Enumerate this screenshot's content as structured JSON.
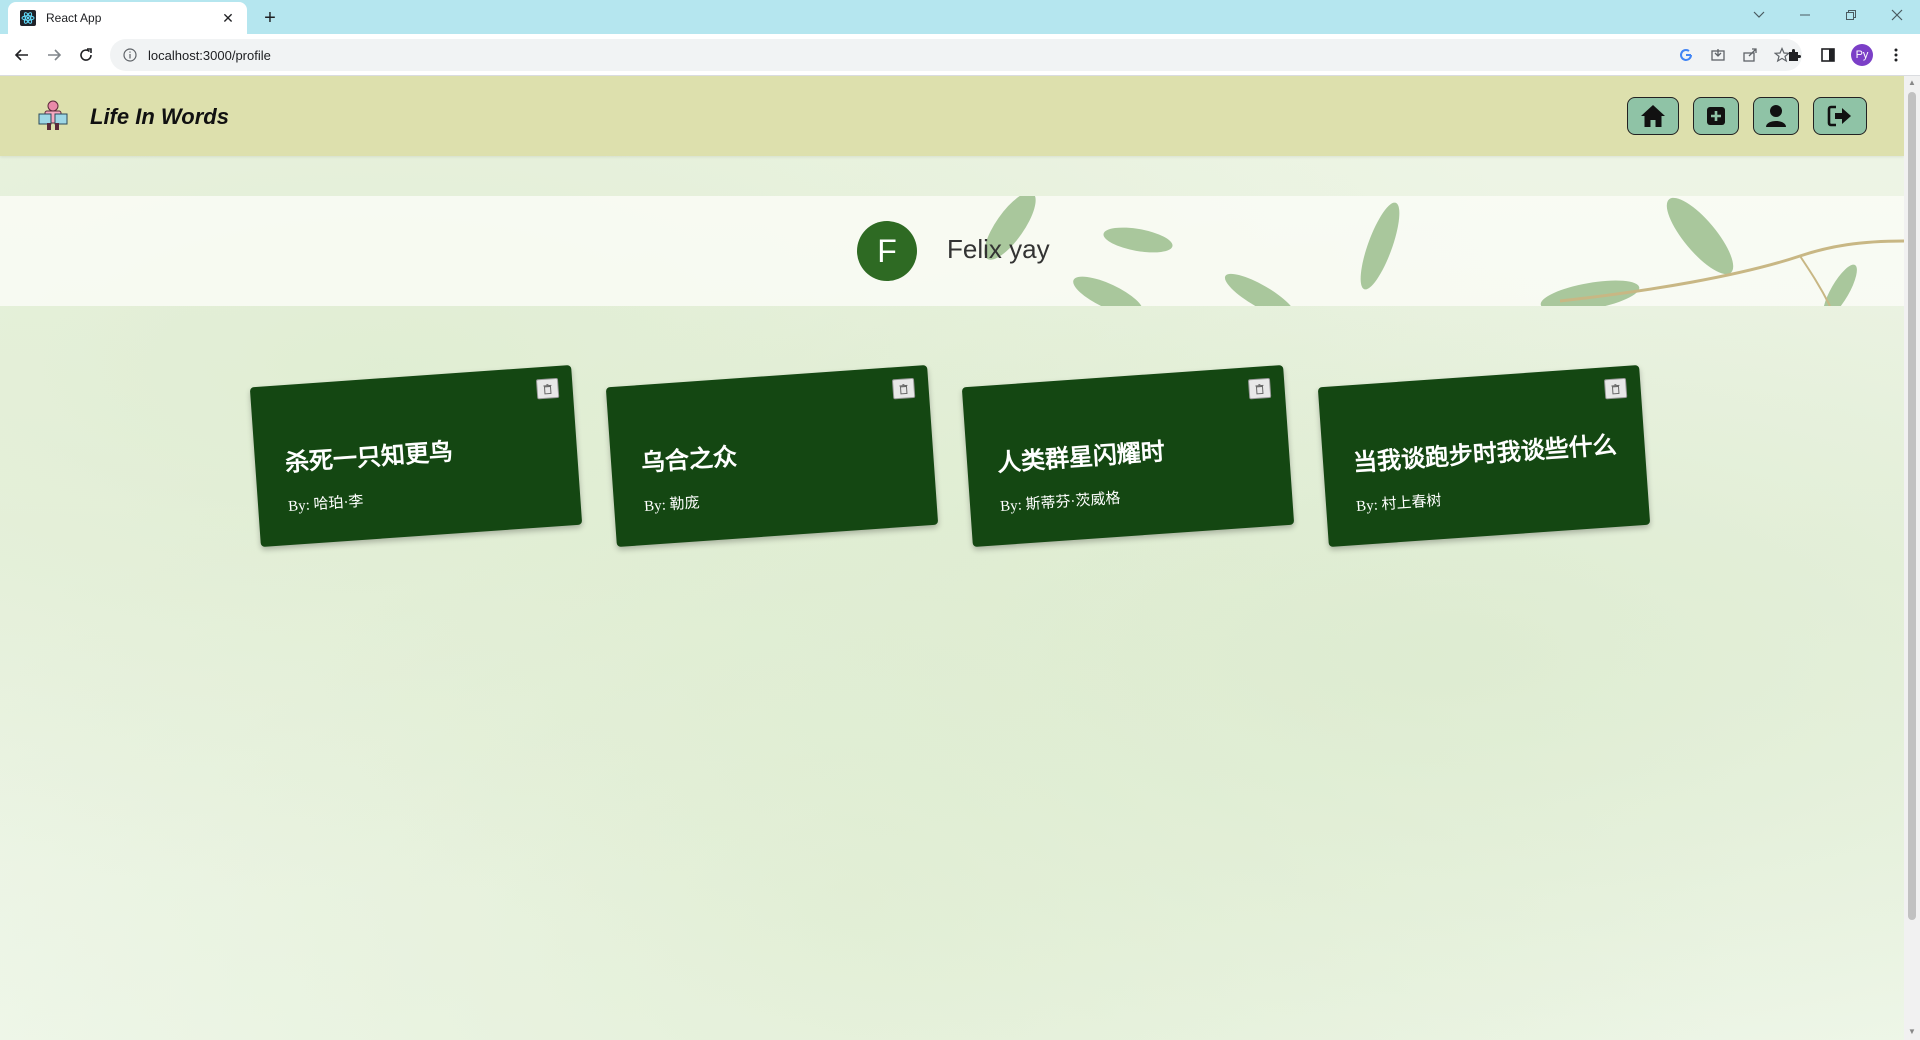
{
  "browser": {
    "tab_title": "React App",
    "new_tab_symbol": "+",
    "close_symbol": "✕",
    "url": "localhost:3000/profile",
    "profile_initials": "Py"
  },
  "app": {
    "title": "Life In Words",
    "header_color": "#dde0ad",
    "nav": [
      {
        "name": "home",
        "icon": "home-icon"
      },
      {
        "name": "add",
        "icon": "plus-square-icon"
      },
      {
        "name": "profile",
        "icon": "user-icon"
      },
      {
        "name": "logout",
        "icon": "logout-icon"
      }
    ]
  },
  "profile": {
    "avatar_letter": "F",
    "name": "Felix yay",
    "avatar_color": "#2e6a23"
  },
  "books": [
    {
      "title": "杀死一只知更鸟",
      "author": "By: 哈珀·李"
    },
    {
      "title": "乌合之众",
      "author": "By: 勒庞"
    },
    {
      "title": "人类群星闪耀时",
      "author": "By: 斯蒂芬·茨威格"
    },
    {
      "title": "当我谈跑步时我谈些什么",
      "author": "By: 村上春树"
    }
  ],
  "colors": {
    "card_bg": "#144712",
    "nav_button_bg": "#8fc3a6"
  }
}
